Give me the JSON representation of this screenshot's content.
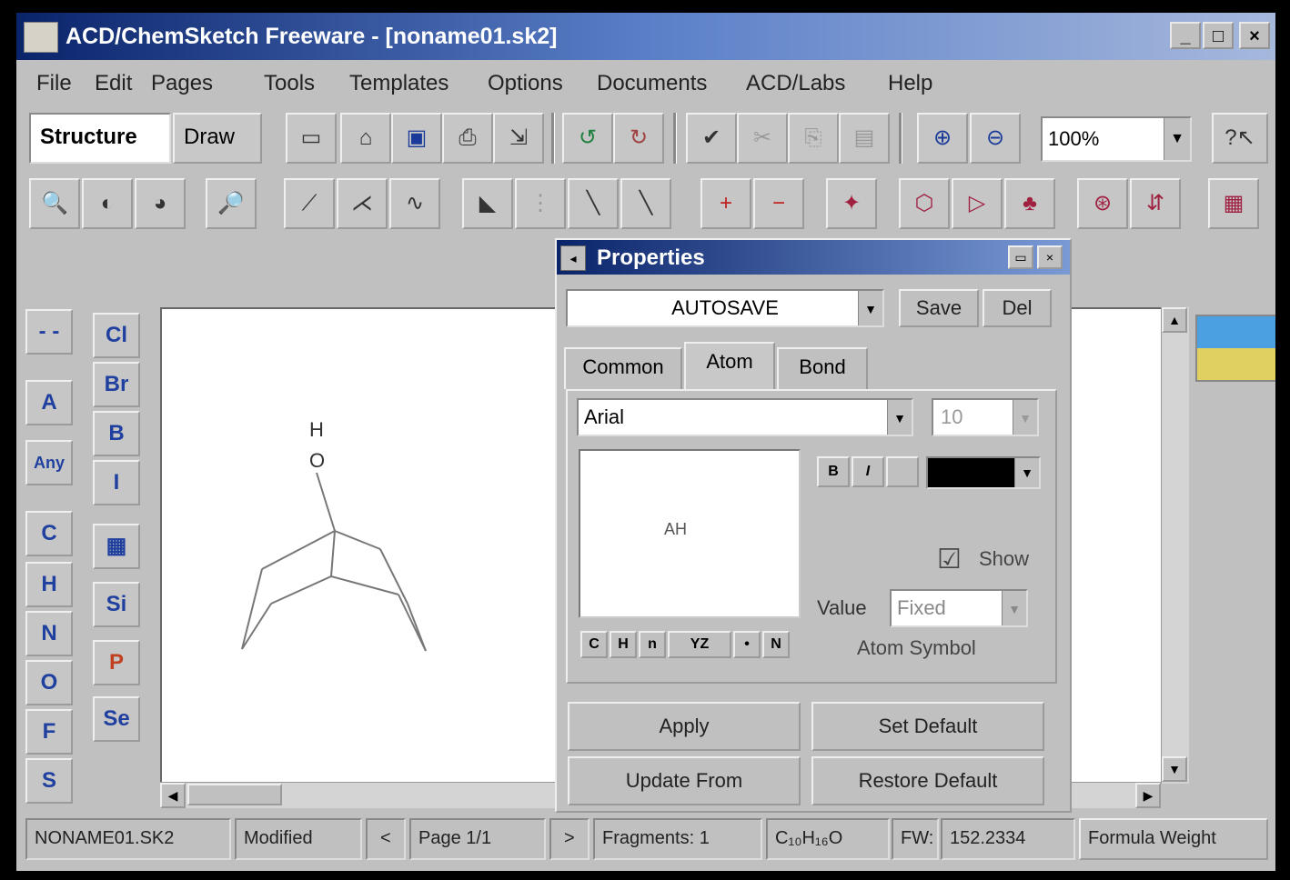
{
  "window": {
    "title": "ACD/ChemSketch Freeware - [noname01.sk2]"
  },
  "menu": [
    "File",
    "Edit",
    "Pages",
    "Tools",
    "Templates",
    "Options",
    "Documents",
    "ACD/Labs",
    "Help"
  ],
  "mode": {
    "structure_label": "Structure",
    "draw_label": "Draw"
  },
  "zoom": {
    "value": "100%"
  },
  "atom_palette": {
    "col1": [
      "A",
      "Any",
      "C",
      "H",
      "N",
      "O",
      "F",
      "S"
    ],
    "col2": [
      "Cl",
      "Br",
      "B",
      "I",
      "Si",
      "P",
      "Se"
    ]
  },
  "molecule": {
    "atom_labels": [
      "H",
      "O"
    ]
  },
  "properties": {
    "title": "Properties",
    "style_value": "AUTOSAVE",
    "save_label": "Save",
    "delete_label": "Del",
    "tabs": [
      "Common",
      "Atom",
      "Bond"
    ],
    "active_tab": "Atom",
    "font_value": "Arial",
    "font_size": "10",
    "bold_label": "B",
    "italic_label": "I",
    "preview_text": "AH",
    "show_label": "Show",
    "value_label": "Value",
    "value_value": "Fixed",
    "atom_symbol_label": "Atom Symbol",
    "apply_label": "Apply",
    "set_default_label": "Set Default",
    "update_from_label": "Update From",
    "restore_default_label": "Restore Default",
    "colors": {
      "title_start": "#0a246a",
      "title_end": "#7a9ad6",
      "font_color": "#000000"
    }
  },
  "status": {
    "filename": "NONAME01.SK2",
    "modified": "Modified",
    "page": "Page 1/1",
    "fragments": "Fragments: 1",
    "formula": "C₁₀H₁₆O",
    "fw_label": "FW:",
    "fw_value": "152.2334",
    "formula_weight_button": "Formula Weight"
  }
}
